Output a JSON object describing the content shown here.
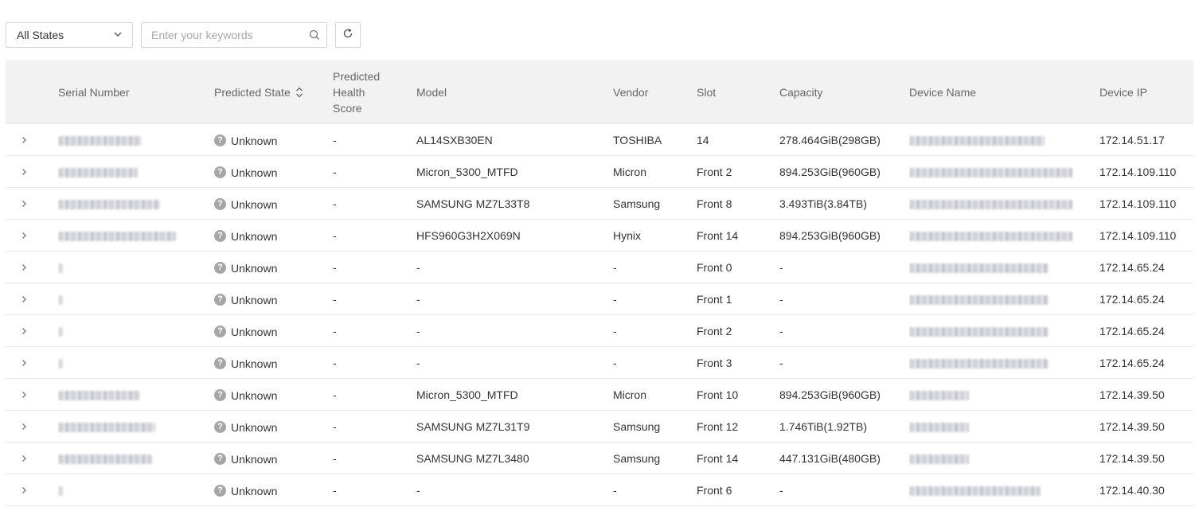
{
  "filter": {
    "state_select": "All States",
    "search_placeholder": "Enter your keywords",
    "search_value": ""
  },
  "icons": {
    "dropdown": "chevron-down-icon",
    "search": "search-icon",
    "refresh": "refresh-icon",
    "expand": "chevron-right-icon",
    "state_unknown": "question-circle-icon",
    "sort": "sort-icon"
  },
  "colors": {
    "header_bg": "#f2f2f2",
    "unknown_icon": "#a6a6a6",
    "border": "#e6e6e6"
  },
  "table": {
    "headers": {
      "serial": "Serial Number",
      "state": "Predicted State",
      "score": "Predicted Health Score",
      "model": "Model",
      "vendor": "Vendor",
      "slot": "Slot",
      "capacity": "Capacity",
      "device_name": "Device Name",
      "device_ip": "Device IP"
    },
    "rows": [
      {
        "serial": "",
        "state": "Unknown",
        "score": "-",
        "model": "AL14SXB30EN",
        "vendor": "TOSHIBA",
        "slot": "14",
        "capacity": "278.464GiB(298GB)",
        "device_name": "",
        "device_ip": "172.14.51.17"
      },
      {
        "serial": "",
        "state": "Unknown",
        "score": "-",
        "model": "Micron_5300_MTFD",
        "vendor": "Micron",
        "slot": "Front 2",
        "capacity": "894.253GiB(960GB)",
        "device_name": "",
        "device_ip": "172.14.109.110"
      },
      {
        "serial": "",
        "state": "Unknown",
        "score": "-",
        "model": "SAMSUNG MZ7L33T8",
        "vendor": "Samsung",
        "slot": "Front 8",
        "capacity": "3.493TiB(3.84TB)",
        "device_name": "",
        "device_ip": "172.14.109.110"
      },
      {
        "serial": "",
        "state": "Unknown",
        "score": "-",
        "model": "HFS960G3H2X069N",
        "vendor": "Hynix",
        "slot": "Front 14",
        "capacity": "894.253GiB(960GB)",
        "device_name": "",
        "device_ip": "172.14.109.110"
      },
      {
        "serial": "",
        "state": "Unknown",
        "score": "-",
        "model": "-",
        "vendor": "-",
        "slot": "Front 0",
        "capacity": "-",
        "device_name": "",
        "device_ip": "172.14.65.24"
      },
      {
        "serial": "",
        "state": "Unknown",
        "score": "-",
        "model": "-",
        "vendor": "-",
        "slot": "Front 1",
        "capacity": "-",
        "device_name": "",
        "device_ip": "172.14.65.24"
      },
      {
        "serial": "",
        "state": "Unknown",
        "score": "-",
        "model": "-",
        "vendor": "-",
        "slot": "Front 2",
        "capacity": "-",
        "device_name": "",
        "device_ip": "172.14.65.24"
      },
      {
        "serial": "",
        "state": "Unknown",
        "score": "-",
        "model": "-",
        "vendor": "-",
        "slot": "Front 3",
        "capacity": "-",
        "device_name": "",
        "device_ip": "172.14.65.24"
      },
      {
        "serial": "",
        "state": "Unknown",
        "score": "-",
        "model": "Micron_5300_MTFD",
        "vendor": "Micron",
        "slot": "Front 10",
        "capacity": "894.253GiB(960GB)",
        "device_name": "",
        "device_ip": "172.14.39.50"
      },
      {
        "serial": "",
        "state": "Unknown",
        "score": "-",
        "model": "SAMSUNG MZ7L31T9",
        "vendor": "Samsung",
        "slot": "Front 12",
        "capacity": "1.746TiB(1.92TB)",
        "device_name": "",
        "device_ip": "172.14.39.50"
      },
      {
        "serial": "",
        "state": "Unknown",
        "score": "-",
        "model": "SAMSUNG MZ7L3480",
        "vendor": "Samsung",
        "slot": "Front 14",
        "capacity": "447.131GiB(480GB)",
        "device_name": "",
        "device_ip": "172.14.39.50"
      },
      {
        "serial": "",
        "state": "Unknown",
        "score": "-",
        "model": "-",
        "vendor": "-",
        "slot": "Front 6",
        "capacity": "-",
        "device_name": "",
        "device_ip": "172.14.40.30"
      }
    ]
  }
}
